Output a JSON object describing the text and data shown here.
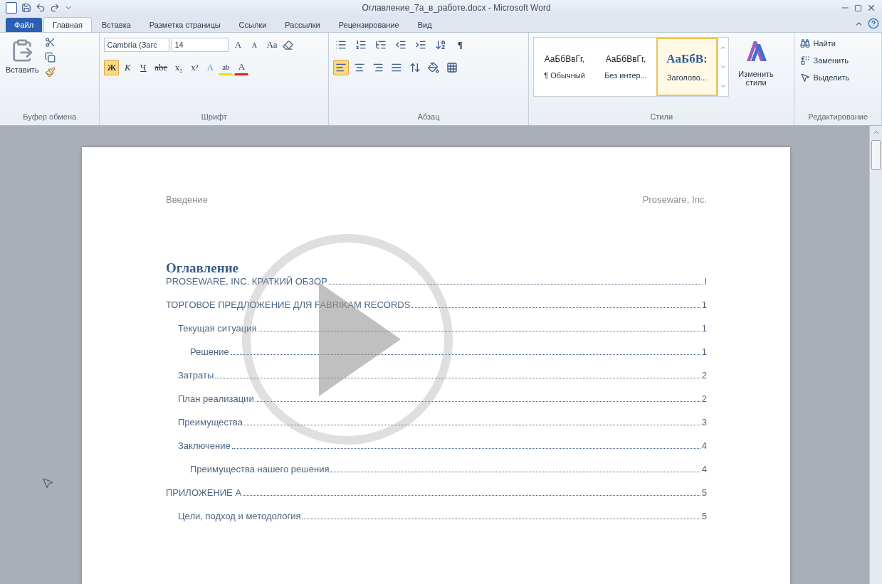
{
  "window": {
    "title": "Оглавление_7а_в_работе.docx  -  Microsoft Word"
  },
  "tabs": [
    {
      "label": "Файл",
      "kind": "file",
      "selected": false
    },
    {
      "label": "Главная",
      "kind": "tab",
      "selected": true
    },
    {
      "label": "Вставка",
      "kind": "tab",
      "selected": false
    },
    {
      "label": "Разметка страницы",
      "kind": "tab",
      "selected": false
    },
    {
      "label": "Ссылки",
      "kind": "tab",
      "selected": false
    },
    {
      "label": "Рассылки",
      "kind": "tab",
      "selected": false
    },
    {
      "label": "Рецензирование",
      "kind": "tab",
      "selected": false
    },
    {
      "label": "Вид",
      "kind": "tab",
      "selected": false
    }
  ],
  "ribbon": {
    "clipboard": {
      "paste": "Вставить",
      "label": "Буфер обмена"
    },
    "font": {
      "name": "Cambria (Загс",
      "size": "14",
      "grow": "A",
      "shrink": "A",
      "case": "Aa",
      "label": "Шрифт",
      "buttons": [
        {
          "label": "Ж",
          "kind": "bold",
          "selected": true
        },
        {
          "label": "К",
          "kind": "italic",
          "selected": false
        },
        {
          "label": "Ч",
          "kind": "underline",
          "selected": false
        },
        {
          "label": "abe",
          "kind": "strike",
          "selected": false
        },
        {
          "label": "x₂",
          "kind": "sub",
          "selected": false
        },
        {
          "label": "x²",
          "kind": "sup",
          "selected": false
        }
      ],
      "effects": [
        "A",
        "ab",
        "A"
      ]
    },
    "paragraph": {
      "label": "Абзац",
      "marks": "¶",
      "alignment": [
        {
          "kind": "left",
          "selected": true
        },
        {
          "kind": "center",
          "selected": false
        },
        {
          "kind": "right",
          "selected": false
        },
        {
          "kind": "justify",
          "selected": false
        }
      ]
    },
    "styles": {
      "label": "Стили",
      "change": "Изменить стили",
      "items": [
        {
          "sample": "АаБбВвГг,",
          "name": "¶ Обычный",
          "kind": "normal",
          "selected": false
        },
        {
          "sample": "АаБбВвГг,",
          "name": "Без интер...",
          "kind": "normal",
          "selected": false
        },
        {
          "sample": "АаБбВ:",
          "name": "Заголово...",
          "kind": "heading",
          "selected": true
        }
      ]
    },
    "editing": {
      "label": "Редактирование",
      "buttons": [
        {
          "label": "Найти",
          "kind": "find"
        },
        {
          "label": "Заменить",
          "kind": "replace"
        },
        {
          "label": "Выделить",
          "kind": "select"
        }
      ]
    }
  },
  "document": {
    "header_left": "Введение",
    "header_right": "Proseware, Inc.",
    "heading": "Оглавление",
    "toc": [
      {
        "text": "PROSEWARE, INC. КРАТКИЙ ОБЗОР",
        "page": "I"
      },
      {
        "text": "ТОРГОВОЕ ПРЕДЛОЖЕНИЕ ДЛЯ FABRIKAM RECORDS",
        "page": "1",
        "children": [
          {
            "text": "Текущая ситуация",
            "page": "1",
            "children": [
              {
                "text": "Решение",
                "page": "1"
              }
            ]
          },
          {
            "text": "Затраты",
            "page": "2"
          },
          {
            "text": "План реализации",
            "page": "2"
          },
          {
            "text": "Преимущества",
            "page": "3"
          },
          {
            "text": "Заключение",
            "page": "4",
            "children": [
              {
                "text": "Преимущества нашего решения",
                "page": "4"
              }
            ]
          }
        ]
      },
      {
        "text": "ПРИЛОЖЕНИЕ А",
        "page": "5",
        "children": [
          {
            "text": "Цели, подход и методология",
            "page": "5"
          }
        ]
      }
    ]
  }
}
